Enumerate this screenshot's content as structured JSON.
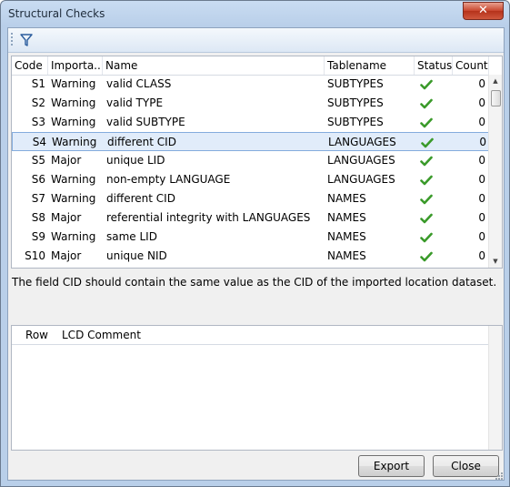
{
  "window": {
    "title": "Structural Checks",
    "close_glyph": "✕"
  },
  "toolbar": {
    "filter_icon": "filter-icon"
  },
  "checks": {
    "columns": [
      "Code",
      "Importa...",
      "Name",
      "Tablename",
      "Status",
      "Count"
    ],
    "rows": [
      {
        "code": "S1",
        "importance": "Warning",
        "name": "valid CLASS",
        "tablename": "SUBTYPES",
        "status": "ok",
        "count": "0"
      },
      {
        "code": "S2",
        "importance": "Warning",
        "name": "valid TYPE",
        "tablename": "SUBTYPES",
        "status": "ok",
        "count": "0"
      },
      {
        "code": "S3",
        "importance": "Warning",
        "name": "valid SUBTYPE",
        "tablename": "SUBTYPES",
        "status": "ok",
        "count": "0"
      },
      {
        "code": "S4",
        "importance": "Warning",
        "name": "different CID",
        "tablename": "LANGUAGES",
        "status": "ok",
        "count": "0",
        "selected": true
      },
      {
        "code": "S5",
        "importance": "Major",
        "name": "unique LID",
        "tablename": "LANGUAGES",
        "status": "ok",
        "count": "0"
      },
      {
        "code": "S6",
        "importance": "Warning",
        "name": "non-empty LANGUAGE",
        "tablename": "LANGUAGES",
        "status": "ok",
        "count": "0"
      },
      {
        "code": "S7",
        "importance": "Warning",
        "name": "different CID",
        "tablename": "NAMES",
        "status": "ok",
        "count": "0"
      },
      {
        "code": "S8",
        "importance": "Major",
        "name": "referential integrity with LANGUAGES",
        "tablename": "NAMES",
        "status": "ok",
        "count": "0"
      },
      {
        "code": "S9",
        "importance": "Warning",
        "name": "same LID",
        "tablename": "NAMES",
        "status": "ok",
        "count": "0"
      },
      {
        "code": "S10",
        "importance": "Major",
        "name": "unique NID",
        "tablename": "NAMES",
        "status": "ok",
        "count": "0"
      }
    ]
  },
  "description": "The field CID should contain the same value as the CID of the imported location dataset.",
  "details": {
    "columns": [
      "Row",
      "LCD Comment"
    ]
  },
  "buttons": {
    "export": "Export",
    "close": "Close"
  },
  "colors": {
    "status_ok": "#3a9a2a",
    "selection": "#e1ecfa"
  }
}
